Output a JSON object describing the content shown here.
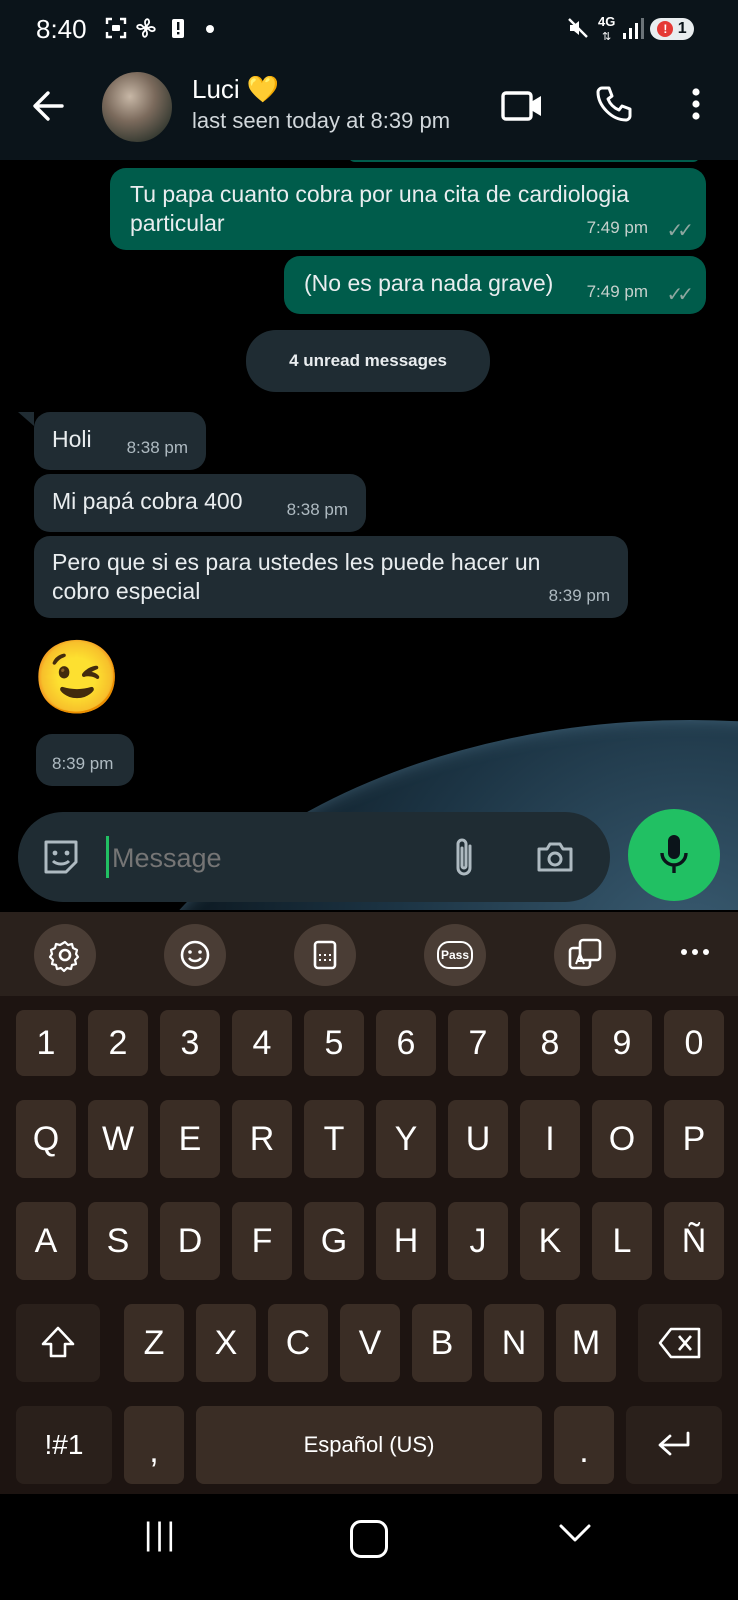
{
  "status_bar": {
    "time": "8:40",
    "network": "4G",
    "notification_count": "1"
  },
  "header": {
    "name": "Luci 💛",
    "subtitle": "last seen today at 8:39 pm"
  },
  "messages": [
    {
      "dir": "out",
      "text": "Tu papa cuanto cobra por una cita de cardiologia particular",
      "time": "7:49 pm",
      "ticks": "✓✓"
    },
    {
      "dir": "out",
      "text": "(No es para nada grave)",
      "time": "7:49 pm",
      "ticks": "✓✓"
    },
    {
      "dir": "in",
      "text": "Holi",
      "time": "8:38 pm"
    },
    {
      "dir": "in",
      "text": "Mi papá cobra 400",
      "time": "8:38 pm"
    },
    {
      "dir": "in",
      "text": "Pero que si es para ustedes les puede hacer un cobro especial",
      "time": "8:39 pm"
    },
    {
      "dir": "in",
      "text": "😉",
      "time": "8:39 pm"
    }
  ],
  "unread_label": "4 unread messages",
  "composer": {
    "placeholder": "Message"
  },
  "keyboard": {
    "numbers": [
      "1",
      "2",
      "3",
      "4",
      "5",
      "6",
      "7",
      "8",
      "9",
      "0"
    ],
    "row1": [
      "Q",
      "W",
      "E",
      "R",
      "T",
      "Y",
      "U",
      "I",
      "O",
      "P"
    ],
    "row2": [
      "A",
      "S",
      "D",
      "F",
      "G",
      "H",
      "J",
      "K",
      "L",
      "Ñ"
    ],
    "row3": [
      "Z",
      "X",
      "C",
      "V",
      "B",
      "N",
      "M"
    ],
    "symbols_label": "!#1",
    "comma_label": ",",
    "space_label": "Español (US)",
    "period_label": ".",
    "toolbar_pass_label": "Pass"
  },
  "nav": {
    "recents_label": "|||"
  }
}
